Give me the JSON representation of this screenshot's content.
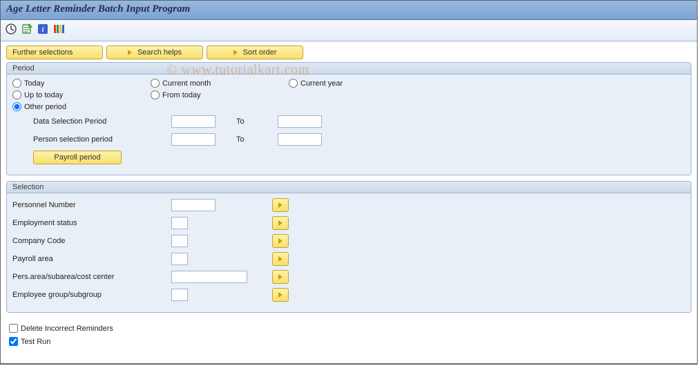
{
  "window": {
    "title": "Age Letter Reminder Batch Input Program"
  },
  "watermark": "© www.tutorialkart.com",
  "toolbar_icons": [
    {
      "name": "execute-icon"
    },
    {
      "name": "execute-print-icon"
    },
    {
      "name": "information-icon"
    },
    {
      "name": "color-legend-icon"
    }
  ],
  "top_buttons": {
    "further_selections": "Further selections",
    "search_helps": "Search helps",
    "sort_order": "Sort order"
  },
  "period": {
    "title": "Period",
    "options": {
      "today": "Today",
      "up_to_today": "Up to today",
      "other_period": "Other period",
      "current_month": "Current month",
      "from_today": "From today",
      "current_year": "Current year"
    },
    "selected": "other_period",
    "data_sel_label": "Data Selection Period",
    "person_sel_label": "Person selection period",
    "to_label": "To",
    "data_from": "",
    "data_to": "",
    "person_from": "",
    "person_to": "",
    "payroll_button": "Payroll period"
  },
  "selection": {
    "title": "Selection",
    "fields": [
      {
        "key": "personnel_number",
        "label": "Personnel Number",
        "width": "w64",
        "value": ""
      },
      {
        "key": "employment_status",
        "label": "Employment status",
        "width": "w24",
        "value": ""
      },
      {
        "key": "company_code",
        "label": "Company Code",
        "width": "w24",
        "value": ""
      },
      {
        "key": "payroll_area",
        "label": "Payroll area",
        "width": "w24",
        "value": ""
      },
      {
        "key": "pers_area",
        "label": "Pers.area/subarea/cost center",
        "width": "w110",
        "value": ""
      },
      {
        "key": "emp_group",
        "label": "Employee group/subgroup",
        "width": "w24",
        "value": ""
      }
    ]
  },
  "options": {
    "delete_incorrect": {
      "label": "Delete Incorrect Reminders",
      "checked": false
    },
    "test_run": {
      "label": "Test Run",
      "checked": true
    }
  }
}
